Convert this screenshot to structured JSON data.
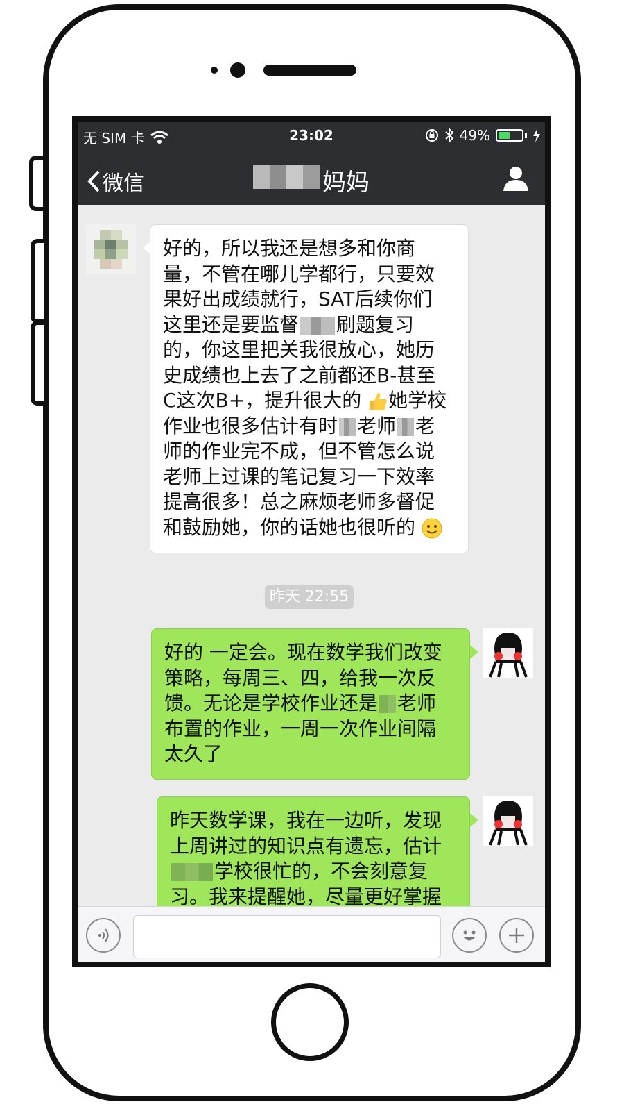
{
  "status_bar": {
    "carrier": "无 SIM 卡",
    "time": "23:02",
    "battery_percent": "49%",
    "battery_level": 0.49
  },
  "nav": {
    "back_label": "微信",
    "title": "妈妈"
  },
  "messages": [
    {
      "direction": "incoming",
      "lines": [
        "好的，所以我还是想多和你商",
        "量，不管在哪儿学都行，只要效",
        "果好出成绩就行，SAT后续你们",
        "这里还是要监督",
        "刷题复习",
        "的，你这里把关我很放心，她历",
        "史成绩也上去了之前都还B-甚至",
        "C这次B+，提升很大的",
        "她学校",
        "作业也很多估计有时",
        "老师",
        "老",
        "师的作业完不成，但不管怎么说",
        "老师上过课的笔记复习一下效率",
        "提高很多！总之麻烦老师多督促",
        "和鼓励她，你的话她也很听的"
      ]
    },
    {
      "direction": "outgoing",
      "lines": [
        "好的 一定会。现在数学我们改变",
        "策略，每周三、四，给我一次反",
        "馈。无论是学校作业还是",
        "老师",
        "布置的作业，一周一次作业间隔",
        "太久了"
      ]
    },
    {
      "direction": "outgoing",
      "lines": [
        "昨天数学课，我在一边听，发现",
        "上周讲过的知识点有遗忘，估计",
        "学校很忙的，不会刻意复",
        "习。我来提醒她，尽量更好掌握"
      ]
    }
  ],
  "timestamp": "昨天 22:55",
  "icons": {
    "wifi": "wifi-icon",
    "lock": "orientation-lock-icon",
    "bluetooth": "bluetooth-icon",
    "charging": "charging-icon",
    "back": "chevron-left-icon",
    "person": "person-icon",
    "voice": "voice-icon",
    "emoji": "emoji-icon",
    "plus": "plus-icon",
    "thumbs_up": "thumbs-up-emoji",
    "smile": "smile-emoji"
  },
  "colors": {
    "nav_bg": "#2d2e31",
    "chat_bg": "#ebebeb",
    "outgoing_bubble": "#9fe65a",
    "incoming_bubble": "#ffffff",
    "battery_green": "#4cd964"
  }
}
